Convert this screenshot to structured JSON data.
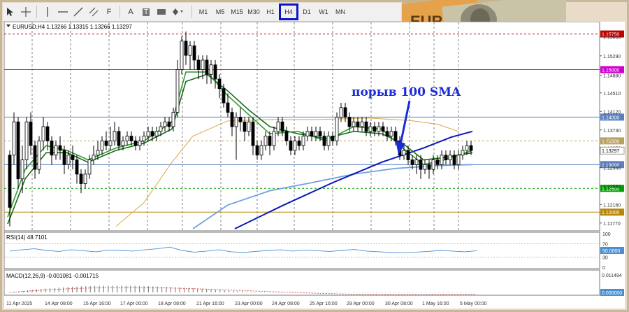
{
  "toolbar": {
    "tools": [
      "cursor-icon",
      "crosshair-icon",
      "vertical-line-icon",
      "horizontal-line-icon",
      "trendline-icon",
      "channel-icon",
      "fibonacci-icon",
      "text-icon",
      "label-icon",
      "rectangle-icon",
      "shapes-icon"
    ],
    "text_tool_glyph": "A",
    "label_tool_glyph": "T",
    "fib_tool_glyph": "F",
    "timeframes": [
      "M1",
      "M5",
      "M15",
      "M30",
      "H1",
      "H4",
      "D1",
      "W1",
      "MN"
    ],
    "active_timeframe": "H4"
  },
  "chart": {
    "symbol_header": "EURUSD,H4  1.13266 1.13315 1.13266 1.13297",
    "annotation": "порыв 100 SMA",
    "price_levels": [
      {
        "label": "1.15750",
        "color": "#c00000",
        "style": "dashed",
        "value": 1.1575
      },
      {
        "label": "1.15000",
        "color": "#d000d0",
        "style": "solid",
        "value": 1.15
      },
      {
        "label": "1.14000",
        "color": "#5b7fbf",
        "style": "solid",
        "value": 1.14
      },
      {
        "label": "1.13500",
        "color": "#b8a060",
        "style": "dashed",
        "value": 1.135
      },
      {
        "label": "1.13000",
        "color": "#5b7fbf",
        "style": "solid",
        "value": 1.13
      },
      {
        "label": "1.12500",
        "color": "#00a000",
        "style": "dashed",
        "value": 1.125
      },
      {
        "label": "1.12000",
        "color": "#b8860b",
        "style": "solid",
        "value": 1.12
      }
    ],
    "price_ticks": [
      "1.15690",
      "1.15290",
      "1.14880",
      "1.14510",
      "1.14120",
      "1.13730",
      "1.13350",
      "1.12940",
      "1.12550",
      "1.12160",
      "1.11770"
    ],
    "current_price": "1.13297",
    "time_ticks": [
      "11 Apr 2025",
      "14 Apr 08:00",
      "15 Apr 16:00",
      "17 Apr 00:00",
      "18 Apr 08:00",
      "21 Apr 16:00",
      "23 Apr 00:00",
      "24 Apr 08:00",
      "25 Apr 16:00",
      "29 Apr 00:00",
      "30 Apr 08:00",
      "1 May 16:00",
      "5 May 00:00"
    ]
  },
  "rsi": {
    "header": "RSI(14) 48.7101",
    "ticks": [
      "100",
      "70",
      "50.0000",
      "30",
      "0"
    ]
  },
  "macd": {
    "header": "MACD(12,26,9) -0.001081 -0.001715",
    "ticks": [
      "0.011494",
      "0.000000"
    ]
  }
}
